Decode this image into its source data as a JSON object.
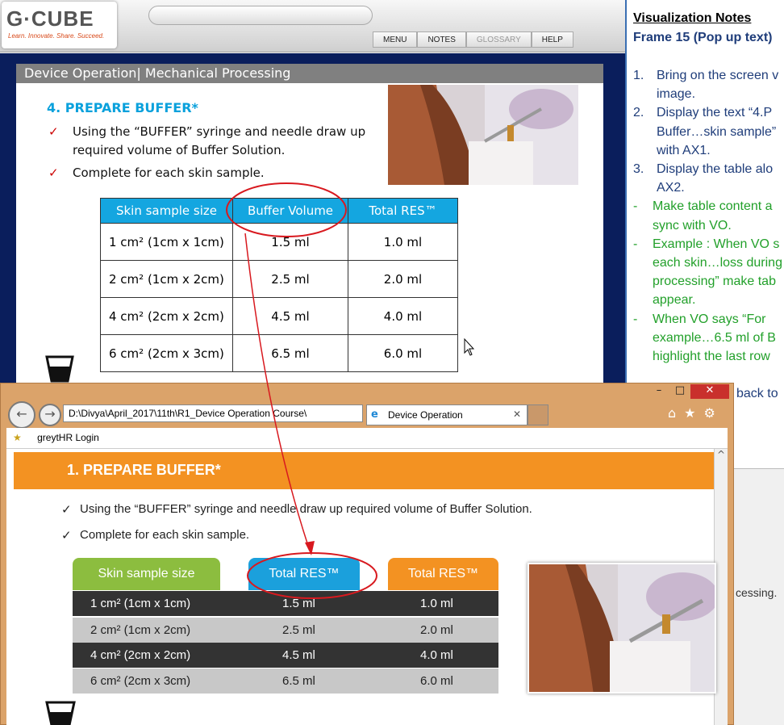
{
  "app": {
    "logo_text": "G·CUBE",
    "logo_tagline": "Learn. Innovate. Share. Succeed.",
    "nav": [
      "MENU",
      "NOTES",
      "GLOSSARY",
      "HELP"
    ]
  },
  "slide": {
    "title": "Device Operation| Mechanical Processing",
    "heading": "4.  PREPARE BUFFER*",
    "bullets": [
      "Using the “BUFFER” syringe and needle draw up required volume of Buffer Solution.",
      "Complete for each skin sample."
    ],
    "table": {
      "headers": [
        "Skin sample size",
        "Buffer Volume",
        "Total RES™"
      ],
      "rows": [
        [
          "1 cm² (1cm x 1cm)",
          "1.5 ml",
          "1.0 ml"
        ],
        [
          "2 cm² (1cm x 2cm)",
          "2.5 ml",
          "2.0 ml"
        ],
        [
          "4 cm² (2cm x 2cm)",
          "4.5 ml",
          "4.0 ml"
        ],
        [
          "6 cm² (2cm x 3cm)",
          "6.5 ml",
          "6.0 ml"
        ]
      ]
    }
  },
  "notes": {
    "title": "Visualization Notes",
    "frame": "Frame 15 (Pop up text)",
    "lines": [
      {
        "prefix": "1.",
        "text": "Bring on the screen v",
        "kind": "blue"
      },
      {
        "prefix": "",
        "text": "image.",
        "kind": "blue"
      },
      {
        "prefix": "2.",
        "text": "Display the text “4.P",
        "kind": "blue"
      },
      {
        "prefix": "",
        "text": "Buffer…skin sample”",
        "kind": "blue"
      },
      {
        "prefix": "",
        "text": "with AX1.",
        "kind": "blue"
      },
      {
        "prefix": "3.",
        "text": "Display the table alo",
        "kind": "blue"
      },
      {
        "prefix": "",
        "text": "AX2.",
        "kind": "blue"
      },
      {
        "prefix": "-",
        "text": "Make table content a",
        "kind": "green"
      },
      {
        "prefix": "",
        "text": "sync with VO.",
        "kind": "green"
      },
      {
        "prefix": "-",
        "text": "Example : When VO s",
        "kind": "green"
      },
      {
        "prefix": "",
        "text": "each skin…loss during",
        "kind": "green"
      },
      {
        "prefix": "",
        "text": "processing” make tab",
        "kind": "green"
      },
      {
        "prefix": "",
        "text": "appear.",
        "kind": "green"
      },
      {
        "prefix": "-",
        "text": "When VO says “For",
        "kind": "green"
      },
      {
        "prefix": "",
        "text": "example…6.5 ml of B",
        "kind": "green"
      },
      {
        "prefix": "",
        "text": "highlight the last row",
        "kind": "green"
      }
    ],
    "trailing": "back to"
  },
  "side_text": "cessing.",
  "browser": {
    "address": "D:\\Divya\\April_2017\\11th\\R1_Device Operation Course\\",
    "tab_title": "Device Operation",
    "favorite": "greytHR Login",
    "heading": "1.  PREPARE BUFFER*",
    "bullets": [
      "Using the “BUFFER” syringe and needle draw up required volume of Buffer Solution.",
      "Complete for each skin sample."
    ],
    "table": {
      "headers": [
        "Skin sample size",
        "Total RES™",
        "Total RES™"
      ],
      "rows": [
        [
          "1 cm² (1cm x 1cm)",
          "1.5 ml",
          "1.0 ml"
        ],
        [
          "2 cm² (1cm x 2cm)",
          "2.5 ml",
          "2.0 ml"
        ],
        [
          "4 cm² (2cm x 2cm)",
          "4.5 ml",
          "4.0 ml"
        ],
        [
          "6 cm² (2cm x 3cm)",
          "6.5 ml",
          "6.0 ml"
        ]
      ]
    }
  },
  "colors": {
    "slide_accent": "#14a6e0",
    "orange_bar": "#f39222",
    "green_header": "#8cbd3f",
    "blue_header": "#1ba0dc",
    "orange_header": "#f39222",
    "annotation": "#d8191f"
  }
}
